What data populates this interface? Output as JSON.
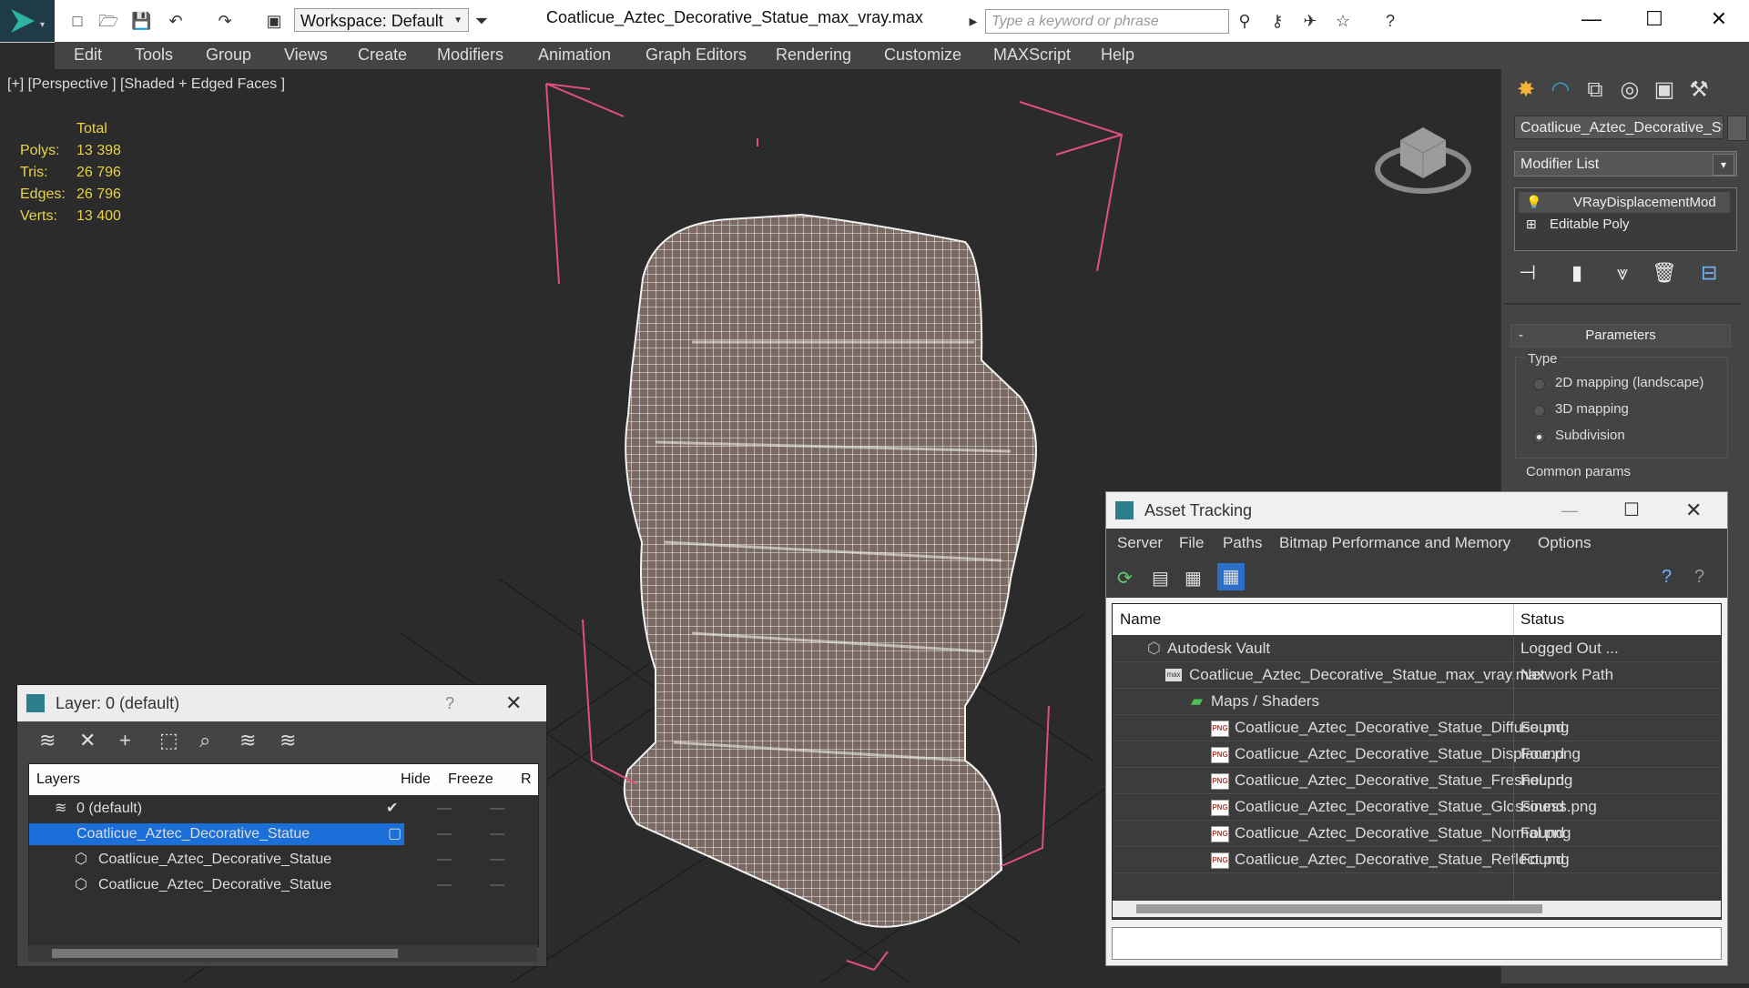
{
  "app": {
    "title": "Coatlicue_Aztec_Decorative_Statue_max_vray.max",
    "workspace": "Workspace: Default",
    "search_placeholder": "Type a keyword or phrase"
  },
  "menu": [
    "Edit",
    "Tools",
    "Group",
    "Views",
    "Create",
    "Modifiers",
    "Animation",
    "Graph Editors",
    "Rendering",
    "Customize",
    "MAXScript",
    "Help"
  ],
  "viewport": {
    "label": "[+] [Perspective ] [Shaded + Edged Faces ]",
    "stats_header": "Total",
    "stats": [
      {
        "key": "Polys:",
        "value": "13 398"
      },
      {
        "key": "Tris:",
        "value": "26 796"
      },
      {
        "key": "Edges:",
        "value": "26 796"
      },
      {
        "key": "Verts:",
        "value": "13 400"
      }
    ]
  },
  "command_panel": {
    "object_name": "Coatlicue_Aztec_Decorative_Stat",
    "modifier_list": "Modifier List",
    "stack": [
      "VRayDisplacementMod",
      "Editable Poly"
    ],
    "rollout_title": "Parameters",
    "type_label": "Type",
    "type_options": [
      {
        "label": "2D mapping (landscape)",
        "selected": false
      },
      {
        "label": "3D mapping",
        "selected": false
      },
      {
        "label": "Subdivision",
        "selected": true
      }
    ],
    "common_params": "Common params"
  },
  "layer_dialog": {
    "title": "Layer: 0 (default)",
    "help": "?",
    "columns": [
      "Layers",
      "Hide",
      "Freeze",
      "R"
    ],
    "rows": [
      {
        "name": "0 (default)",
        "indent": 0,
        "selected": false
      },
      {
        "name": "Coatlicue_Aztec_Decorative_Statue",
        "indent": 0,
        "selected": true
      },
      {
        "name": "Coatlicue_Aztec_Decorative_Statue",
        "indent": 1,
        "selected": false
      },
      {
        "name": "Coatlicue_Aztec_Decorative_Statue",
        "indent": 1,
        "selected": false
      }
    ]
  },
  "asset_dialog": {
    "title": "Asset Tracking",
    "menu": [
      "Server",
      "File",
      "Paths",
      "Bitmap Performance and Memory",
      "Options"
    ],
    "columns": [
      "Name",
      "Status"
    ],
    "rows": [
      {
        "name": "Autodesk Vault",
        "status": "Logged Out ...",
        "icon": "vault"
      },
      {
        "name": "Coatlicue_Aztec_Decorative_Statue_max_vray.max",
        "status": "Network Path",
        "icon": "max"
      },
      {
        "name": "Maps / Shaders",
        "status": "",
        "icon": "maps"
      },
      {
        "name": "Coatlicue_Aztec_Decorative_Statue_Diffuse.png",
        "status": "Found",
        "icon": "png"
      },
      {
        "name": "Coatlicue_Aztec_Decorative_Statue_Displace.png",
        "status": "Found",
        "icon": "png"
      },
      {
        "name": "Coatlicue_Aztec_Decorative_Statue_Fresnel.png",
        "status": "Found",
        "icon": "png"
      },
      {
        "name": "Coatlicue_Aztec_Decorative_Statue_Glossiness.png",
        "status": "Found",
        "icon": "png"
      },
      {
        "name": "Coatlicue_Aztec_Decorative_Statue_Normal.png",
        "status": "Found",
        "icon": "png"
      },
      {
        "name": "Coatlicue_Aztec_Decorative_Statue_Reflect.png",
        "status": "Found",
        "icon": "png"
      }
    ]
  }
}
